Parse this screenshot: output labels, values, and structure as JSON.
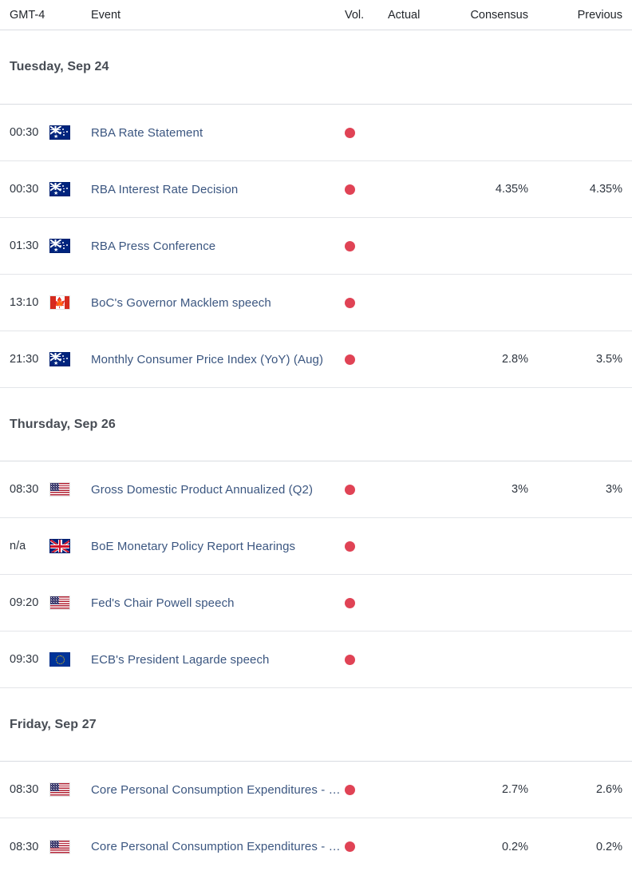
{
  "header": {
    "timezone": "GMT-4",
    "event": "Event",
    "vol": "Vol.",
    "actual": "Actual",
    "consensus": "Consensus",
    "previous": "Previous"
  },
  "colors": {
    "volatility_high": "#e04355",
    "event_link": "#3b5680",
    "text": "#2f3640",
    "divider": "#e3e5e9"
  },
  "days": [
    {
      "title": "Tuesday, Sep 24",
      "events": [
        {
          "time": "00:30",
          "country": "AU",
          "flag_icon": "flag-australia-icon",
          "name": "RBA Rate Statement",
          "volatility": "high",
          "actual": "",
          "consensus": "",
          "previous": ""
        },
        {
          "time": "00:30",
          "country": "AU",
          "flag_icon": "flag-australia-icon",
          "name": "RBA Interest Rate Decision",
          "volatility": "high",
          "actual": "",
          "consensus": "4.35%",
          "previous": "4.35%"
        },
        {
          "time": "01:30",
          "country": "AU",
          "flag_icon": "flag-australia-icon",
          "name": "RBA Press Conference",
          "volatility": "high",
          "actual": "",
          "consensus": "",
          "previous": ""
        },
        {
          "time": "13:10",
          "country": "CA",
          "flag_icon": "flag-canada-icon",
          "name": "BoC's Governor Macklem speech",
          "volatility": "high",
          "actual": "",
          "consensus": "",
          "previous": ""
        },
        {
          "time": "21:30",
          "country": "AU",
          "flag_icon": "flag-australia-icon",
          "name": "Monthly Consumer Price Index (YoY) (Aug)",
          "volatility": "high",
          "actual": "",
          "consensus": "2.8%",
          "previous": "3.5%"
        }
      ]
    },
    {
      "title": "Thursday, Sep 26",
      "events": [
        {
          "time": "08:30",
          "country": "US",
          "flag_icon": "flag-united-states-icon",
          "name": "Gross Domestic Product Annualized (Q2)",
          "volatility": "high",
          "actual": "",
          "consensus": "3%",
          "previous": "3%"
        },
        {
          "time": "n/a",
          "country": "GB",
          "flag_icon": "flag-united-kingdom-icon",
          "name": "BoE Monetary Policy Report Hearings",
          "volatility": "high",
          "actual": "",
          "consensus": "",
          "previous": ""
        },
        {
          "time": "09:20",
          "country": "US",
          "flag_icon": "flag-united-states-icon",
          "name": "Fed's Chair Powell speech",
          "volatility": "high",
          "actual": "",
          "consensus": "",
          "previous": ""
        },
        {
          "time": "09:30",
          "country": "EU",
          "flag_icon": "flag-european-union-icon",
          "name": "ECB's President Lagarde speech",
          "volatility": "high",
          "actual": "",
          "consensus": "",
          "previous": ""
        }
      ]
    },
    {
      "title": "Friday, Sep 27",
      "events": [
        {
          "time": "08:30",
          "country": "US",
          "flag_icon": "flag-united-states-icon",
          "name": "Core Personal Consumption Expenditures - Pri…",
          "volatility": "high",
          "actual": "",
          "consensus": "2.7%",
          "previous": "2.6%"
        },
        {
          "time": "08:30",
          "country": "US",
          "flag_icon": "flag-united-states-icon",
          "name": "Core Personal Consumption Expenditures - Pri…",
          "volatility": "high",
          "actual": "",
          "consensus": "0.2%",
          "previous": "0.2%"
        }
      ]
    }
  ]
}
